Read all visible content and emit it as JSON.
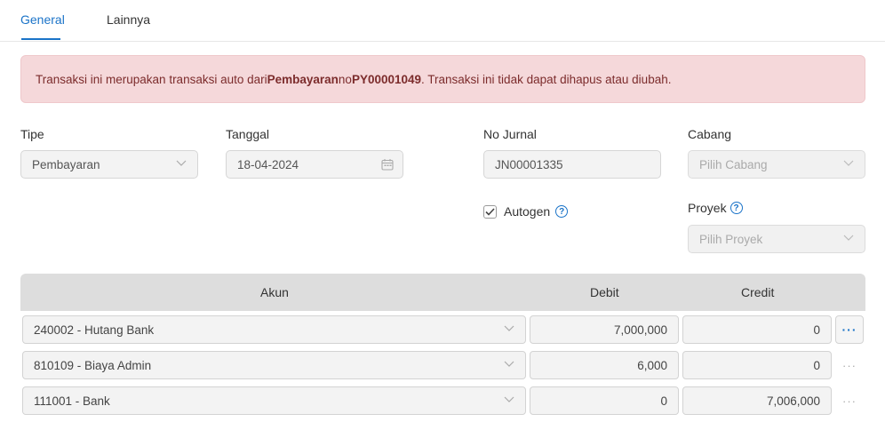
{
  "tabs": [
    {
      "label": "General",
      "active": true
    },
    {
      "label": "Lainnya",
      "active": false
    }
  ],
  "alert": {
    "prefix": "Transaksi ini merupakan transaksi auto dari ",
    "source_type": "Pembayaran",
    "middle": " no ",
    "source_no": "PY00001049",
    "suffix": ". Transaksi ini tidak dapat dihapus atau diubah."
  },
  "form": {
    "tipe": {
      "label": "Tipe",
      "value": "Pembayaran"
    },
    "tanggal": {
      "label": "Tanggal",
      "value": "18-04-2024"
    },
    "no_jurnal": {
      "label": "No Jurnal",
      "value": "JN00001335"
    },
    "cabang": {
      "label": "Cabang",
      "placeholder": "Pilih Cabang"
    },
    "autogen": {
      "label": "Autogen",
      "checked": true
    },
    "proyek": {
      "label": "Proyek",
      "placeholder": "Pilih Proyek"
    }
  },
  "table": {
    "headers": {
      "akun": "Akun",
      "debit": "Debit",
      "credit": "Credit"
    },
    "rows": [
      {
        "akun": "240002 - Hutang Bank",
        "debit": "7,000,000",
        "credit": "0"
      },
      {
        "akun": "810109 - Biaya Admin",
        "debit": "6,000",
        "credit": "0"
      },
      {
        "akun": "111001 - Bank",
        "debit": "0",
        "credit": "7,006,000"
      }
    ],
    "more_label": "···"
  },
  "colors": {
    "accent": "#1a73c8",
    "alert_bg": "#f5d8da",
    "alert_text": "#7c2c2c"
  },
  "icons": {
    "calendar": "calendar-icon",
    "chevron": "chevron-down-icon",
    "help": "help-circle-icon",
    "check": "check-icon",
    "more": "more-horizontal-icon"
  }
}
